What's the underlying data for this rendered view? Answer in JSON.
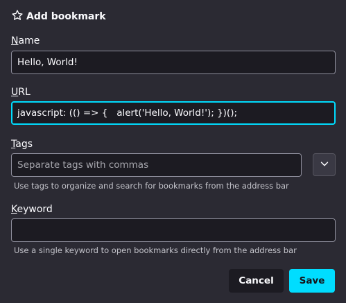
{
  "header": {
    "title": "Add bookmark",
    "icon": "star-outline-icon"
  },
  "fields": {
    "name": {
      "label_key": "N",
      "label_rest": "ame",
      "value": "Hello, World!"
    },
    "url": {
      "label_key": "U",
      "label_rest": "RL",
      "value": "javascript: (() => {   alert('Hello, World!'); })();"
    },
    "tags": {
      "label_key": "T",
      "label_rest": "ags",
      "value": "",
      "placeholder": "Separate tags with commas",
      "hint": "Use tags to organize and search for bookmarks from the address bar"
    },
    "keyword": {
      "label_key": "K",
      "label_rest": "eyword",
      "value": "",
      "hint": "Use a single keyword to open bookmarks directly from the address bar"
    }
  },
  "buttons": {
    "cancel": "Cancel",
    "save": "Save"
  },
  "colors": {
    "background": "#2b2a33",
    "accent": "#00ddff",
    "field_bg": "#1c1b22",
    "text": "#fbfbfe"
  }
}
